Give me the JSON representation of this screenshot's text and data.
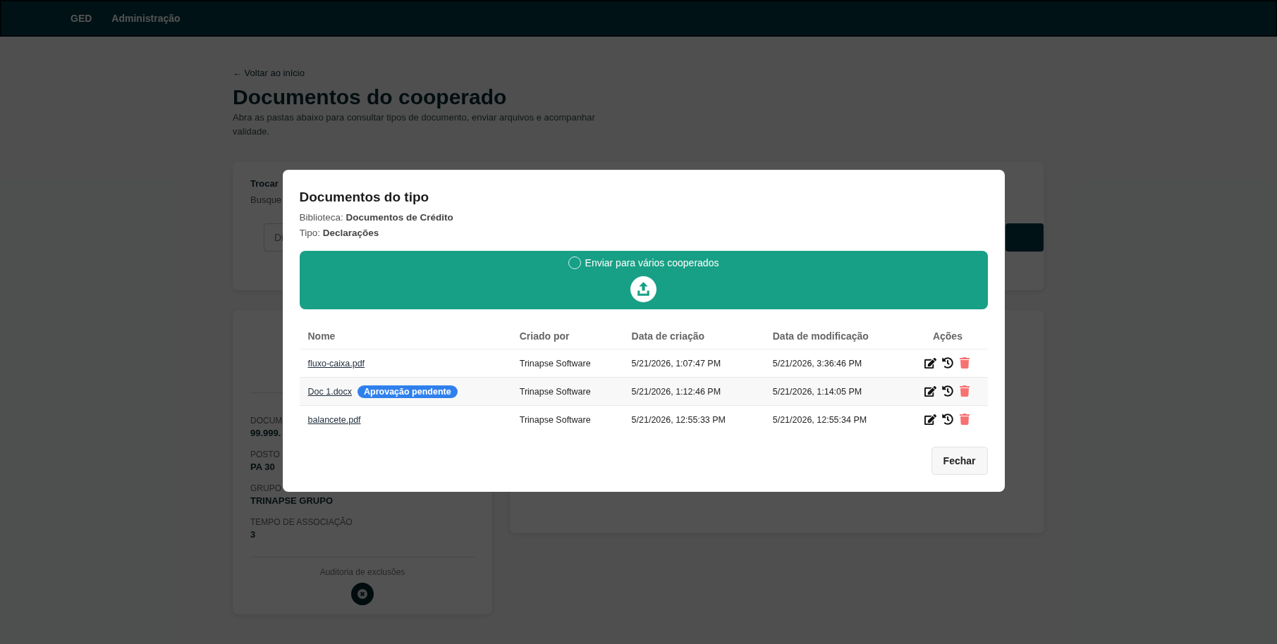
{
  "nav": {
    "items": [
      {
        "label": "GED"
      },
      {
        "label": "Administração"
      }
    ]
  },
  "page": {
    "back_link": "← Voltar ao início",
    "title": "Documentos do cooperado",
    "subtitle": "Abra as pastas abaixo para consultar tipos de documento, enviar arquivos e acompanhar validade."
  },
  "search_card": {
    "title": "Trocar",
    "hint": "Busque",
    "placeholder": "Di"
  },
  "profile_card": {
    "fields": [
      {
        "label": "DOCUM",
        "value": "99.999."
      },
      {
        "label": "POSTO",
        "value": "PA 30"
      },
      {
        "label": "GRUPO",
        "value": "TRINAPSE GRUPO"
      },
      {
        "label": "TEMPO DE ASSOCIAÇÃO",
        "value": "3"
      }
    ],
    "audit_label": "Auditoria de exclusões"
  },
  "modal": {
    "title": "Documentos do tipo",
    "meta": [
      "Biblioteca: **Documentos de Crédito**",
      "Tipo: **Declarações**"
    ],
    "upload": {
      "checkbox_label": "Enviar para vários cooperados",
      "checked": false
    },
    "columns": [
      "Nome",
      "Criado por",
      "Data de criação",
      "Data de modificação",
      "Ações"
    ],
    "rows": [
      {
        "name": "fluxo-caixa.pdf",
        "created_by": "Trinapse Software",
        "created_at": "5/21/2026, 1:07:47 PM",
        "modified_at": "5/21/2026, 3:36:46 PM"
      },
      {
        "name": "Doc 1.docx",
        "badge": "Aprovação pendente",
        "created_by": "Trinapse Software",
        "created_at": "5/21/2026, 1:12:46 PM",
        "modified_at": "5/21/2026, 1:14:05 PM"
      },
      {
        "name": "balancete.pdf",
        "created_by": "Trinapse Software",
        "created_at": "5/21/2026, 12:55:33 PM",
        "modified_at": "5/21/2026, 12:55:34 PM"
      }
    ],
    "close_button": "Fechar"
  }
}
